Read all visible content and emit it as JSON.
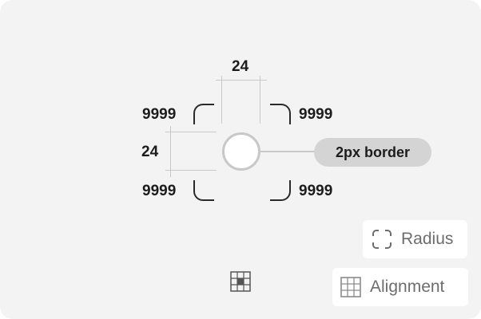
{
  "diagram": {
    "radius_top_left": "9999",
    "radius_top_right": "9999",
    "radius_bottom_left": "9999",
    "radius_bottom_right": "9999",
    "width_label": "24",
    "height_label": "24",
    "border_label": "2px border"
  },
  "toolbar": {
    "radius_label": "Radius",
    "alignment_label": "Alignment",
    "radius_icon": "corners-dashed-icon",
    "alignment_icon": "grid-icon"
  },
  "alignment_indicator_icon": "alignment-grid-center-icon"
}
